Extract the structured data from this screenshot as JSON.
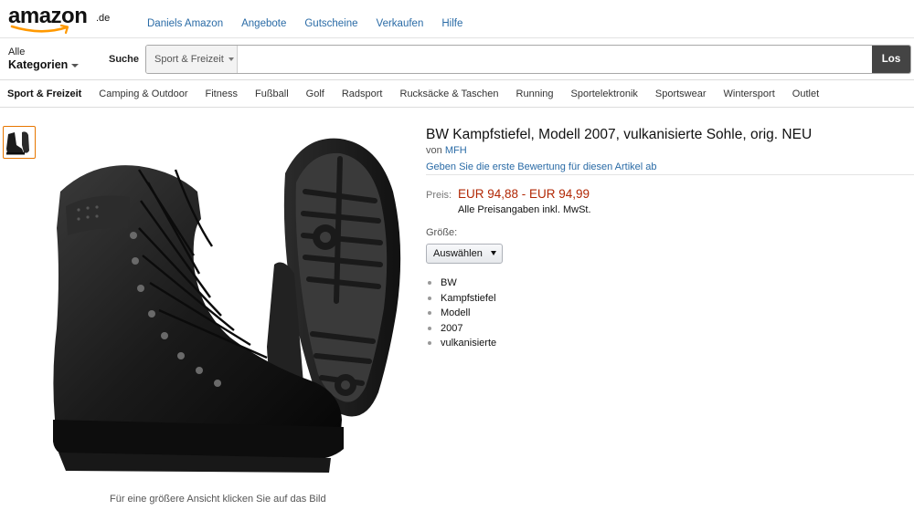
{
  "header": {
    "logo_text": "amazon",
    "logo_tld": ".de",
    "nav": [
      "Daniels Amazon",
      "Angebote",
      "Gutscheine",
      "Verkaufen",
      "Hilfe"
    ]
  },
  "search": {
    "category_small": "Alle",
    "category_big": "Kategorien",
    "label": "Suche",
    "scope": "Sport & Freizeit",
    "value": "",
    "placeholder": "",
    "go_label": "Los"
  },
  "subnav": {
    "items": [
      "Sport & Freizeit",
      "Camping & Outdoor",
      "Fitness",
      "Fußball",
      "Golf",
      "Radsport",
      "Rucksäcke & Taschen",
      "Running",
      "Sportelektronik",
      "Sportswear",
      "Wintersport",
      "Outlet"
    ]
  },
  "gallery": {
    "zoom_hint": "Für eine größere Ansicht klicken Sie auf das Bild"
  },
  "product": {
    "title": "BW Kampfstiefel, Modell 2007, vulkanisierte Sohle, orig. NEU",
    "by_prefix": "von",
    "brand": "MFH",
    "review_link": "Geben Sie die erste Bewertung für diesen Artikel ab",
    "price_label": "Preis:",
    "price": "EUR 94,88 - EUR 94,99",
    "price_note": "Alle Preisangaben inkl. MwSt.",
    "size_label": "Größe:",
    "size_selected": "Auswählen",
    "bullets": [
      "BW",
      "Kampfstiefel",
      "Modell",
      "2007",
      "vulkanisierte"
    ]
  },
  "colors": {
    "link": "#2a6ba6",
    "price": "#b12704",
    "logo_smile": "#ff9900",
    "thumb_border": "#e77600"
  }
}
